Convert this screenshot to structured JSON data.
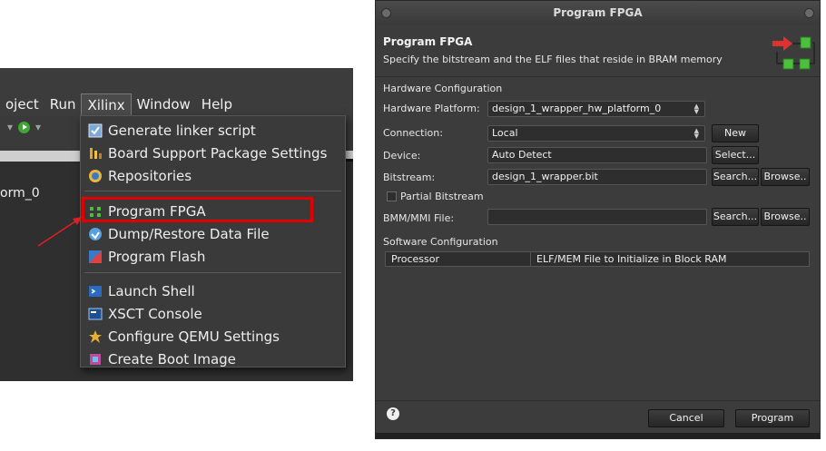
{
  "menubar": {
    "items": [
      "oject",
      "Run",
      "Xilinx",
      "Window",
      "Help"
    ],
    "active_index": 2
  },
  "toolbar": {
    "icons": [
      "run-icon",
      "dropdown-arrow-icon"
    ]
  },
  "project_tree": {
    "item_label": "orm_0"
  },
  "xilinx_menu": {
    "items": [
      {
        "label": "Generate linker script",
        "icon": "linker-script-icon"
      },
      {
        "label": "Board Support Package Settings",
        "icon": "bsp-settings-icon"
      },
      {
        "label": "Repositories",
        "icon": "repositories-icon"
      },
      {
        "label": "Program FPGA",
        "icon": "program-fpga-icon"
      },
      {
        "label": "Dump/Restore Data File",
        "icon": "dump-restore-icon"
      },
      {
        "label": "Program Flash",
        "icon": "program-flash-icon"
      },
      {
        "label": "Launch Shell",
        "icon": "launch-shell-icon"
      },
      {
        "label": "XSCT Console",
        "icon": "xsct-console-icon"
      },
      {
        "label": "Configure QEMU Settings",
        "icon": "qemu-settings-icon"
      },
      {
        "label": "Create Boot Image",
        "icon": "boot-image-icon"
      }
    ]
  },
  "dialog": {
    "window_title": "Program FPGA",
    "header_title": "Program FPGA",
    "header_description": "Specify the bitstream and the ELF files that reside in BRAM memory",
    "hardware_section": "Hardware Configuration",
    "hardware_platform_label": "Hardware Platform:",
    "hardware_platform_value": "design_1_wrapper_hw_platform_0",
    "connection_label": "Connection:",
    "connection_value": "Local",
    "new_button": "New",
    "device_label": "Device:",
    "device_value": "Auto Detect",
    "select_button": "Select...",
    "bitstream_label": "Bitstream:",
    "bitstream_value": "design_1_wrapper.bit",
    "search_button": "Search...",
    "browse_button": "Browse..",
    "partial_bitstream_label": "Partial Bitstream",
    "partial_bitstream_checked": false,
    "bmm_label": "BMM/MMI File:",
    "bmm_value": "",
    "software_section": "Software Configuration",
    "table_columns": [
      "Processor",
      "ELF/MEM File to Initialize in Block RAM"
    ],
    "help_glyph": "?",
    "cancel_button": "Cancel",
    "program_button": "Program"
  },
  "colors": {
    "highlight_box": "#e00000",
    "annotation_arrow": "#e02020",
    "dialog_bg": "#3c3c3c",
    "menu_bg": "#3a3a3a"
  }
}
